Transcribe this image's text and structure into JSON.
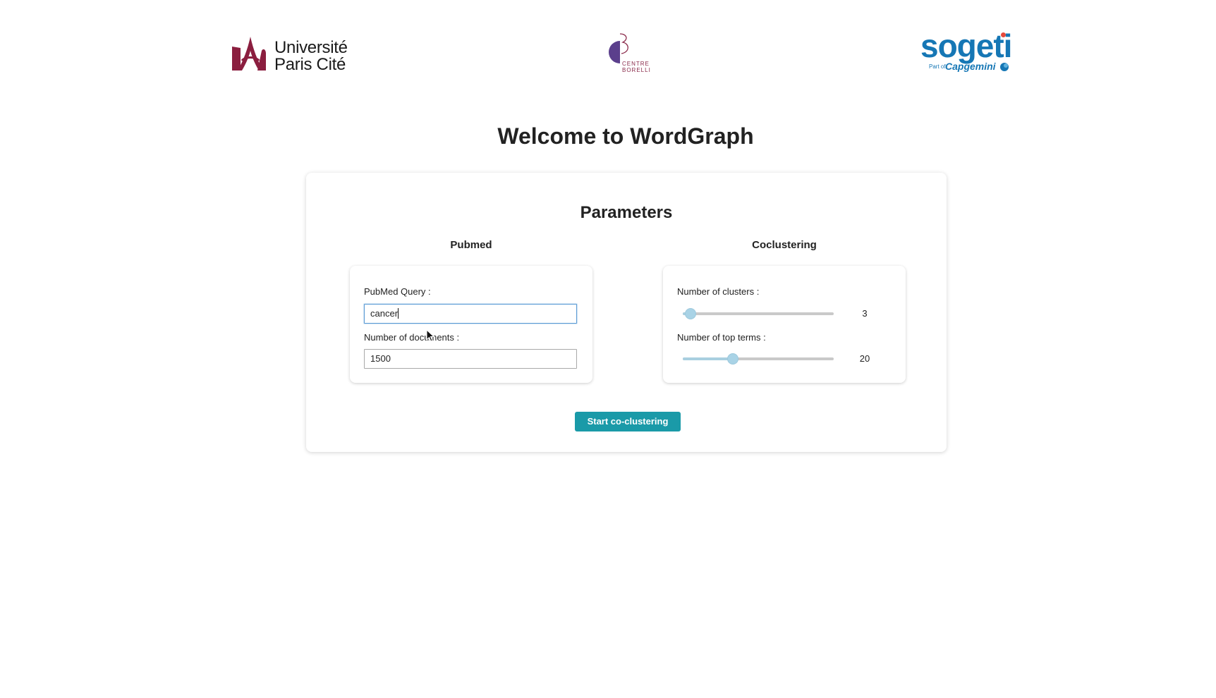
{
  "header": {
    "logos": [
      {
        "name": "universite-paris-cite-logo",
        "line1": "Université",
        "line2": "Paris Cité",
        "color": "#8b1e3f"
      },
      {
        "name": "centre-borelli-logo",
        "line1": "CENTRE",
        "line2": "BORELLI",
        "color": "#5b3f8c"
      },
      {
        "name": "sogeti-logo",
        "brand": "sogeti",
        "sub_prefix": "Part of",
        "sub_brand": "Capgemini",
        "color": "#1677b5"
      }
    ]
  },
  "page": {
    "title": "Welcome to WordGraph"
  },
  "parameters": {
    "title": "Parameters",
    "pubmed": {
      "section_title": "Pubmed",
      "query_label": "PubMed Query :",
      "query_value": "cancer",
      "docs_label": "Number of documents :",
      "docs_value": "1500"
    },
    "coclustering": {
      "section_title": "Coclustering",
      "clusters_label": "Number of clusters :",
      "clusters_value": "3",
      "clusters_fraction": 0.05,
      "top_terms_label": "Number of top terms :",
      "top_terms_value": "20",
      "top_terms_fraction": 0.33
    },
    "start_button": "Start co-clustering"
  },
  "colors": {
    "accent": "#1a9aa8",
    "slider_thumb": "#a9d3e6",
    "focus_border": "#5b9bd5"
  }
}
